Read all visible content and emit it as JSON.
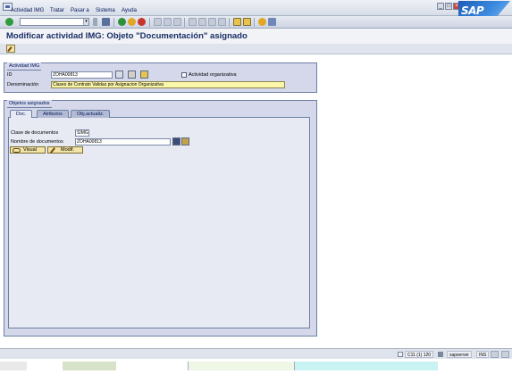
{
  "menu": {
    "items": [
      {
        "label": "Actividad IMG",
        "underline": "A"
      },
      {
        "label": "Tratar",
        "underline": "T"
      },
      {
        "label": "Pasar a",
        "underline": "P"
      },
      {
        "label": "Sistema",
        "underline": "S"
      },
      {
        "label": "Ayuda",
        "underline": "y"
      }
    ],
    "logo_text": "SAP"
  },
  "toolbar": {
    "command_value": "",
    "icons": [
      "enter-icon",
      "save-icon",
      "back-icon",
      "exit-icon",
      "cancel-icon",
      "print-icon",
      "find-icon",
      "find-next-icon",
      "first-page-icon",
      "previous-page-icon",
      "next-page-icon",
      "last-page-icon",
      "create-session-icon",
      "shortcut-icon",
      "help-icon",
      "layout-menu-icon"
    ]
  },
  "title": "Modificar actividad IMG: Objeto \"Documentación\" asignado",
  "actividad_img": {
    "group_title": "Actividad IMG",
    "id_label": "ID",
    "id_value": "ZOHA00813",
    "checkbox_label": "Actividad organizativa",
    "checkbox_checked": false,
    "denominacion_label": "Denominación",
    "denominacion_value": "Clases de Contrato Validas por Asignacion Organizativa"
  },
  "objetos": {
    "group_title": "Objetos asignados",
    "tabs": [
      {
        "label": "Doc.",
        "active": true
      },
      {
        "label": "Atributos",
        "active": false
      },
      {
        "label": "Obj.actualiz.",
        "active": false
      }
    ],
    "clase_label": "Clase de documentos",
    "clase_value": "SIMG",
    "nombre_label": "Nombre de documentos",
    "nombre_value": "ZOHA00813",
    "visual_label": "Visual",
    "modif_label": "Modif."
  },
  "status": {
    "system": "C11 (1) 120",
    "server": "sapserver",
    "mode": "INS"
  }
}
